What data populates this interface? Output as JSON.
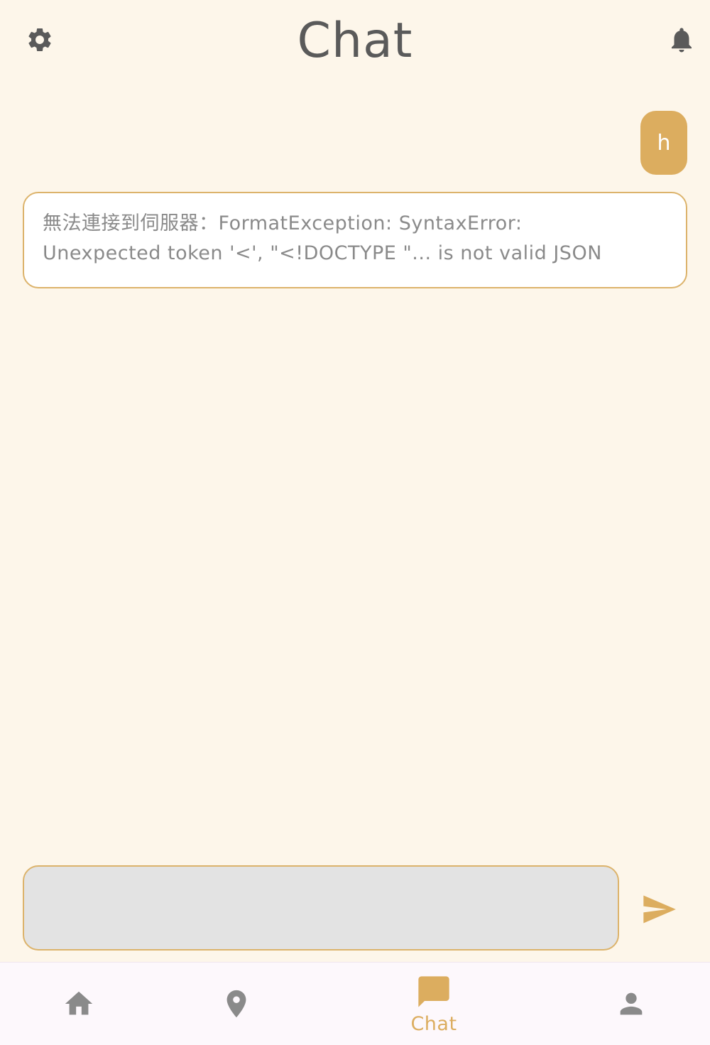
{
  "header": {
    "title": "Chat",
    "left_icon": "gear-icon",
    "right_icon": "bell-icon"
  },
  "messages": [
    {
      "role": "user",
      "text": "h"
    },
    {
      "role": "bot",
      "text": "無法連接到伺服器：FormatException: SyntaxError:\nUnexpected token '<', \"<!DOCTYPE \"... is not valid JSON"
    }
  ],
  "composer": {
    "value": "",
    "placeholder": "",
    "send_icon": "send-icon"
  },
  "nav": {
    "items": [
      {
        "icon": "home-icon",
        "label": ""
      },
      {
        "icon": "location-pin-icon",
        "label": ""
      },
      {
        "icon": "chat-bubble-icon",
        "label": "Chat",
        "active": true
      },
      {
        "icon": "person-icon",
        "label": ""
      }
    ]
  },
  "colors": {
    "background": "#fdf6ea",
    "accent": "#dcad5f",
    "border": "#dcb36b",
    "icon_dark": "#5a5a5a",
    "icon_muted": "#8a8a8a"
  }
}
